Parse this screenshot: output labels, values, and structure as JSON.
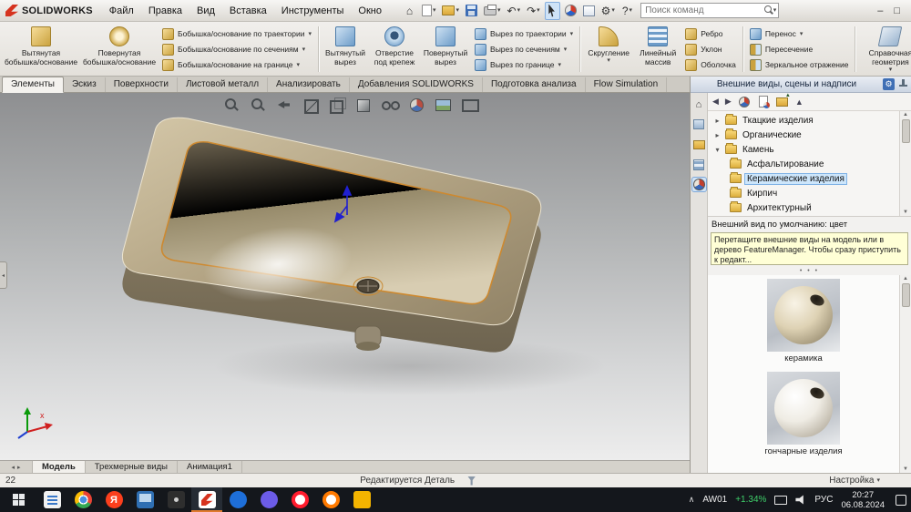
{
  "icons": {
    "caret": "▾",
    "chevron_right": "▸",
    "chevron_down": "▾",
    "back": "◀",
    "forward": "▶",
    "up_small": "▲",
    "down_small": "▼",
    "left_small": "◂",
    "right_small": "▸",
    "home": "⌂",
    "undo": "↶",
    "redo": "↷",
    "gear": "⚙",
    "help": "?",
    "minimize": "–",
    "restore": "□",
    "dots": "• • •",
    "tray_caret": "∧"
  },
  "menubar": {
    "brand": "SOLIDWORKS",
    "items": [
      "Файл",
      "Правка",
      "Вид",
      "Вставка",
      "Инструменты",
      "Окно"
    ],
    "search_placeholder": "Поиск команд"
  },
  "ribbon": {
    "col1": [
      {
        "line1": "Вытянутая",
        "line2": "бобышка/основание"
      },
      {
        "line1": "Повернутая",
        "line2": "бобышка/основание"
      }
    ],
    "stack1": [
      "Бобышка/основание по траектории",
      "Бобышка/основание по сечениям",
      "Бобышка/основание на границе"
    ],
    "col2": [
      {
        "line1": "Вытянутый",
        "line2": "вырез"
      },
      {
        "line1": "Отверстие",
        "line2": "под крепеж"
      },
      {
        "line1": "Повернутый",
        "line2": "вырез"
      }
    ],
    "stack2": [
      "Вырез по траектории",
      "Вырез по сечениям",
      "Вырез по границе"
    ],
    "col3": [
      {
        "line1": "Скругление",
        "line2": ""
      },
      {
        "line1": "Линейный",
        "line2": "массив"
      }
    ],
    "stack3": [
      "Ребро",
      "Уклон",
      "Оболочка"
    ],
    "stack4": [
      "Перенос",
      "Пересечение",
      "Зеркальное отражение"
    ],
    "col4": [
      {
        "line1": "Справочная",
        "line2": "геометрия"
      }
    ]
  },
  "tabs": {
    "items": [
      "Элементы",
      "Эскиз",
      "Поверхности",
      "Листовой металл",
      "Анализировать",
      "Добавления SOLIDWORKS",
      "Подготовка анализа",
      "Flow Simulation"
    ],
    "active": "Элементы"
  },
  "viewport": {
    "triad_x": "x"
  },
  "taskpane": {
    "title": "Внешние виды, сцены и надписи",
    "tree": [
      {
        "label": "Ткацкие изделия"
      },
      {
        "label": "Органические"
      },
      {
        "label": "Камень"
      },
      {
        "label": "Асфальтирование"
      },
      {
        "label": "Керамические изделия"
      },
      {
        "label": "Кирпич"
      },
      {
        "label": "Архитектурный"
      }
    ],
    "default_appearance": "Внешний вид по умолчанию: цвет",
    "tooltip": "Перетащите внешние виды на модель или в дерево FeatureManager.  Чтобы сразу приступить к редакт...",
    "thumbnails": [
      {
        "caption": "керамика"
      },
      {
        "caption": "гончарные изделия"
      }
    ]
  },
  "model_tabs": {
    "items": [
      "Модель",
      "Трехмерные виды",
      "Анимация1"
    ],
    "active": "Модель"
  },
  "statusbar": {
    "left_value": "22",
    "editing": "Редактируется Деталь",
    "settings": "Настройка"
  },
  "taskbar": {
    "yandex_letter": "Я",
    "tray": {
      "ticker": "AW01",
      "change": "+1.34%",
      "lang": "РУС",
      "time": "20:27",
      "date": "06.08.2024"
    }
  }
}
